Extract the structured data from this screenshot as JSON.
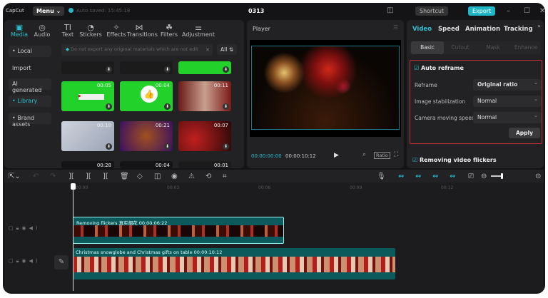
{
  "titlebar": {
    "logo": "CapCut",
    "menu": "Menu ⌄",
    "autosave": "Auto saved: 15:45:18",
    "project": "0313",
    "shortcut": "Shortcut",
    "export": "Export"
  },
  "media_tabs": [
    {
      "label": "Media",
      "icon": "media-icon",
      "glyph": "▣"
    },
    {
      "label": "Audio",
      "icon": "audio-icon",
      "glyph": "◎"
    },
    {
      "label": "Text",
      "icon": "text-icon",
      "glyph": "TI"
    },
    {
      "label": "Stickers",
      "icon": "sticker-icon",
      "glyph": "◔"
    },
    {
      "label": "Effects",
      "icon": "effects-icon",
      "glyph": "✧"
    },
    {
      "label": "Transitions",
      "icon": "transitions-icon",
      "glyph": "⋈"
    },
    {
      "label": "Filters",
      "icon": "filters-icon",
      "glyph": "☘"
    },
    {
      "label": "Adjustment",
      "icon": "adjustment-icon",
      "glyph": "⚌"
    }
  ],
  "sidebar": [
    "• Local",
    "Import",
    "AI generated",
    "• Library",
    "• Brand assets"
  ],
  "notice": "Do not export any original materials which are not edit",
  "filter": "All",
  "thumbs": [
    {
      "dur": "",
      "bg": "#1b1b1b"
    },
    {
      "dur": "",
      "bg": "#1b1b1b"
    },
    {
      "dur": "",
      "bg": "#22d12a"
    },
    {
      "dur": "00:05",
      "bg": "#22d12a"
    },
    {
      "dur": "00:04",
      "bg": "#22d12a"
    },
    {
      "dur": "00:11",
      "bg": "linear-gradient(90deg,#6b1a18,#c8a090,#7a1a18)"
    },
    {
      "dur": "00:10",
      "bg": "linear-gradient(135deg,#cfd3dc,#9aa3b5)"
    },
    {
      "dur": "00:21",
      "bg": "radial-gradient(circle,#a05020,#3a1060)"
    },
    {
      "dur": "00:07",
      "bg": "radial-gradient(circle at 30% 60%,#c02020,#2a0808)"
    },
    {
      "dur": "00:28",
      "bg": "#141416"
    },
    {
      "dur": "00:04",
      "bg": "#141416"
    },
    {
      "dur": "00:01",
      "bg": "#1b1b1b"
    }
  ],
  "player": {
    "title": "Player",
    "current": "00:00:00:00",
    "total": "00:00:10:12",
    "ratio": "Ratio"
  },
  "right": {
    "tabs": [
      "Video",
      "Speed",
      "Animation",
      "Tracking"
    ],
    "subtabs": [
      "Basic",
      "Cutout",
      "Mask",
      "Enhance"
    ],
    "auto_reframe": "Auto reframe",
    "reframe_label": "Reframe",
    "reframe_value": "Original ratio",
    "stab_label": "Image stabilization",
    "stab_value": "Normal",
    "cam_label": "Camera moving speed",
    "cam_value": "Normal",
    "apply": "Apply",
    "flicker": "Removing video flickers"
  },
  "ruler": [
    "00:00",
    "00:03",
    "00:06",
    "00:09",
    "00:12"
  ],
  "clips": [
    {
      "label": "Removing flickers  真实烟花  00:00:06:22"
    },
    {
      "label": "Christmas snowglobe and Christmas gifts on table  00:00:10:12"
    }
  ],
  "colors": {
    "accent": "#2bc0d0",
    "highlight_box": "#c0303a",
    "clip": "#0d5a5c"
  }
}
